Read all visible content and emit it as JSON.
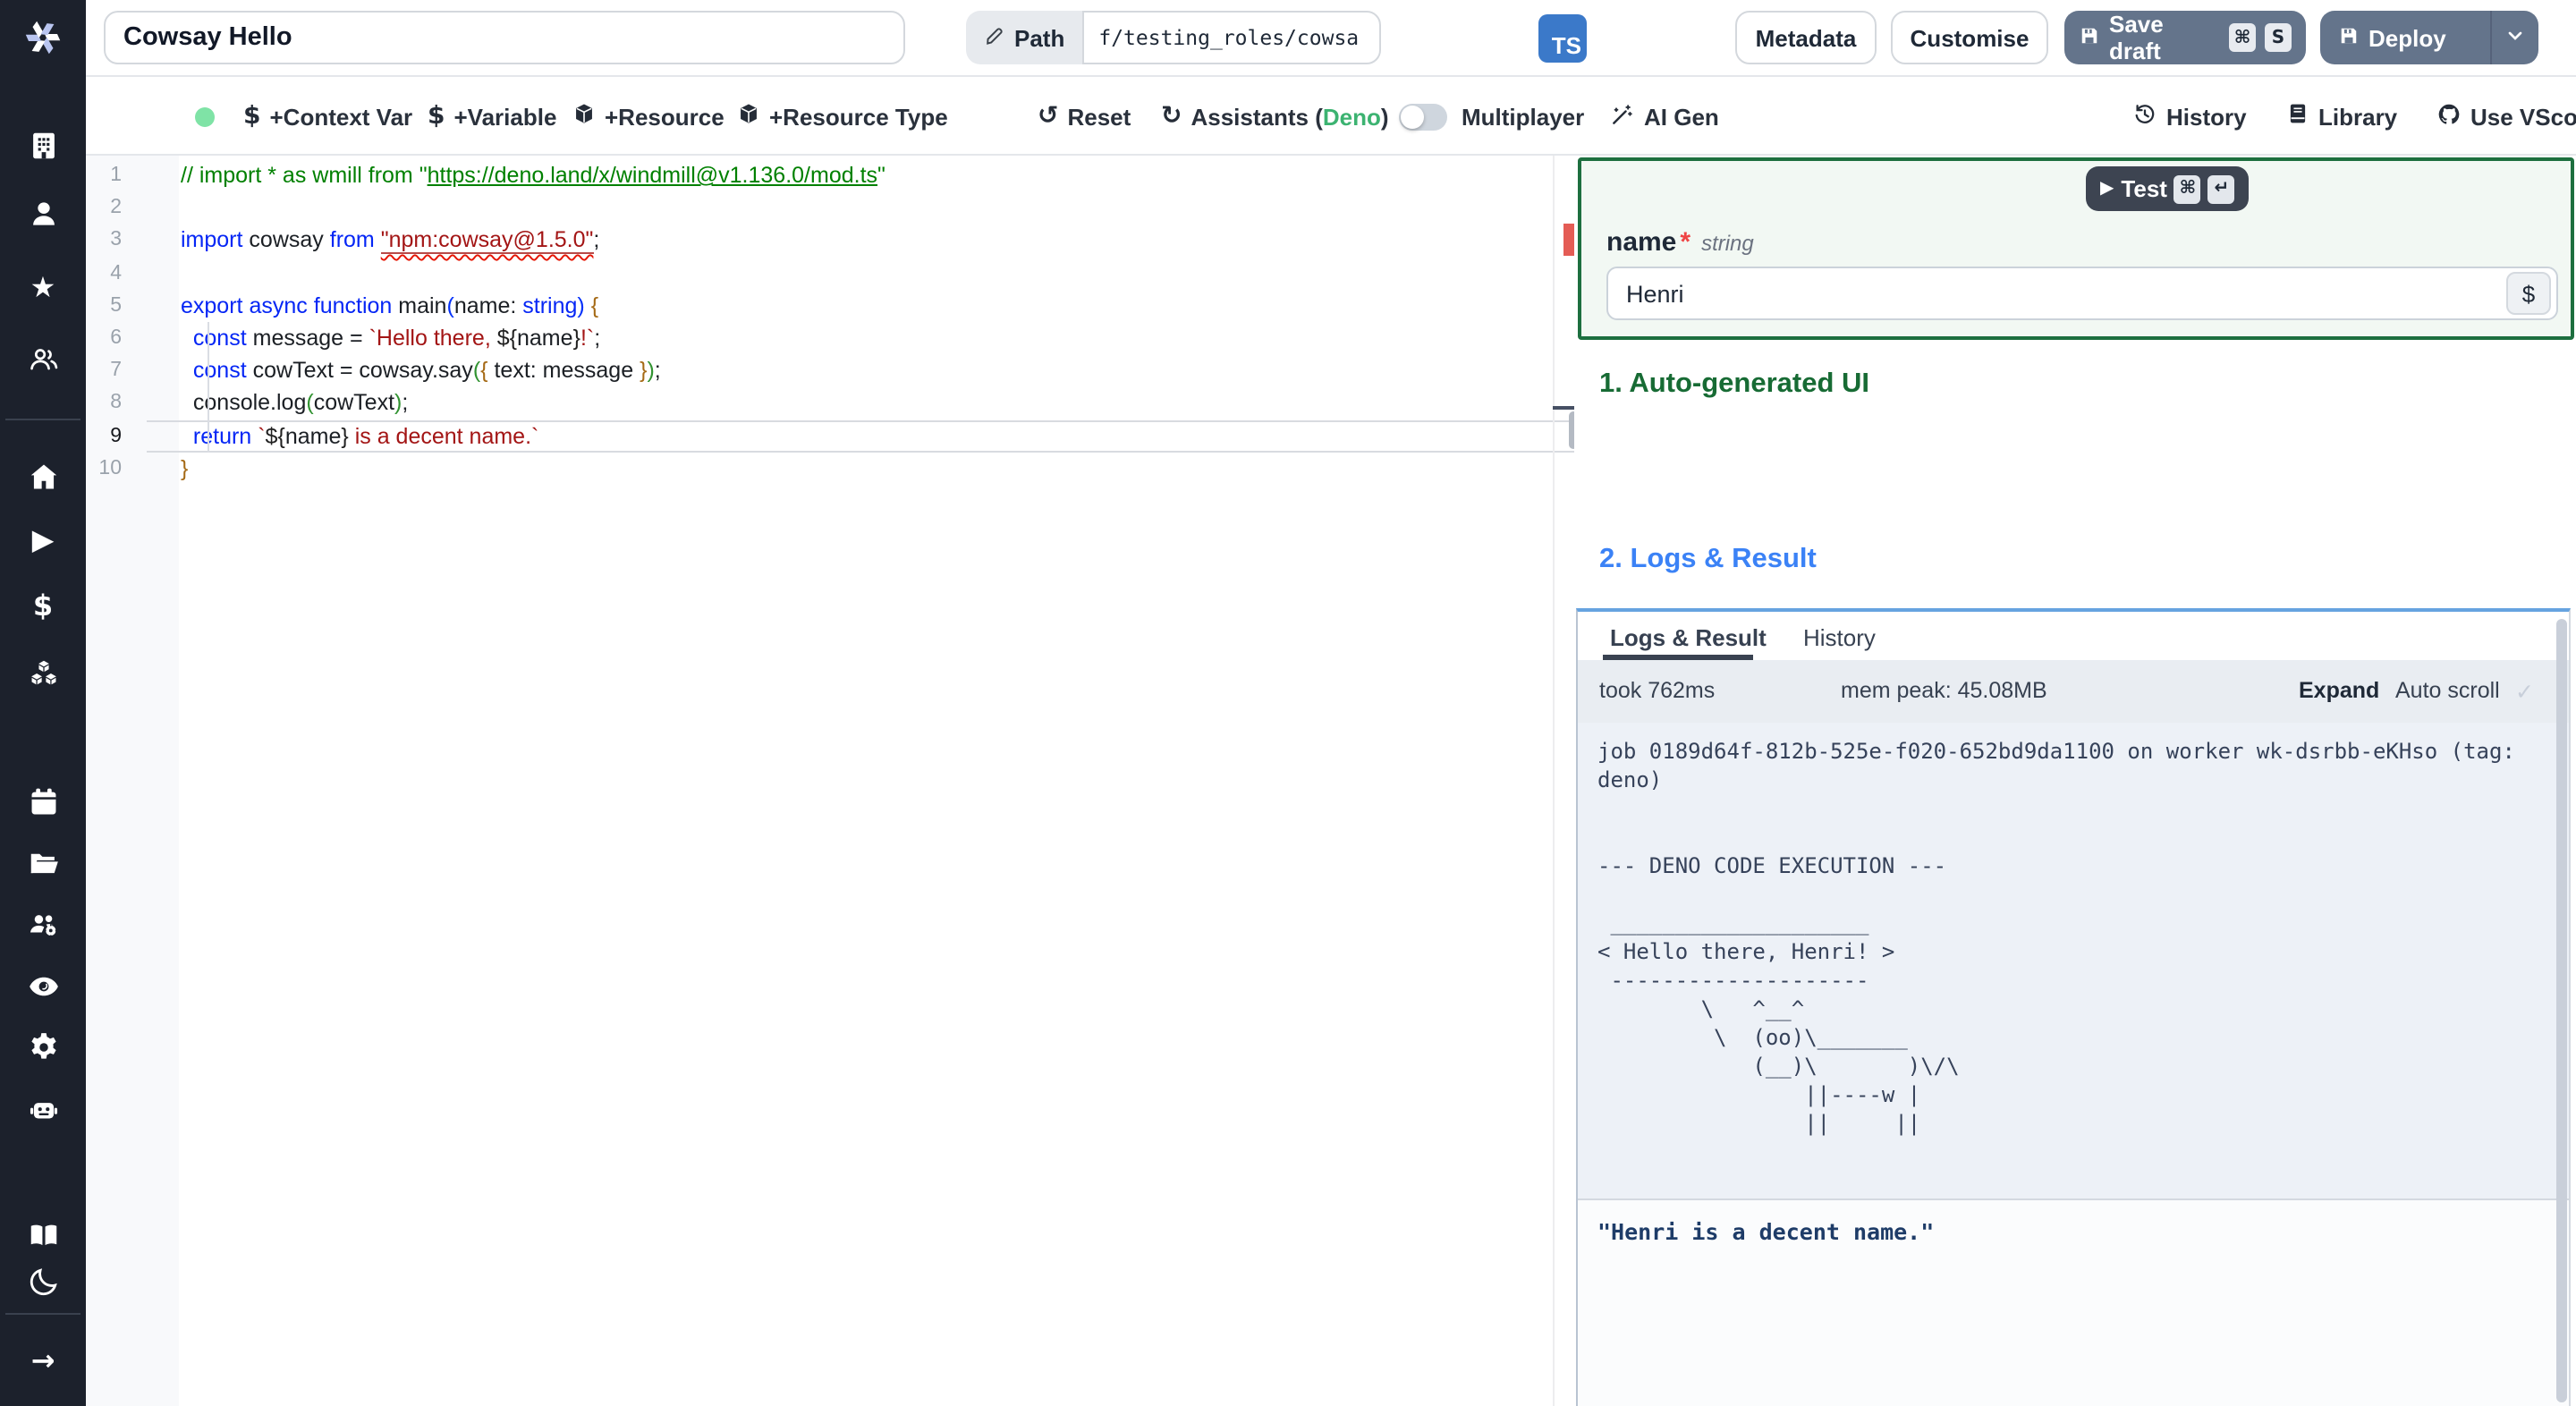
{
  "colors": {
    "sidebar_bg": "#1c212c",
    "button_slate": "#64748b",
    "ts_badge_blue": "#3b79c9",
    "args_border_green": "#1d6f3f",
    "heading_green": "#176b34",
    "heading_blue": "#3b82f6",
    "logs_top_border_blue": "#66a3e0",
    "error_marker_red": "#e45c55",
    "status_dot_green": "#7fe3a6",
    "deno_green": "#3cb371"
  },
  "icons": {
    "dollar": "$",
    "reset": "↺",
    "refresh": "↻",
    "star": "★",
    "play": "▶",
    "arrow_right": "→",
    "check": "✓",
    "command": "⌘",
    "return": "↵",
    "chevron_down": "⌄"
  },
  "topbar": {
    "title_value": "Cowsay Hello",
    "path_label": "Path",
    "path_value": "f/testing_roles/cowsa",
    "lang_badge": "TS",
    "metadata_label": "Metadata",
    "customise_label": "Customise",
    "save_draft_label": "Save draft",
    "save_kbd_1": "⌘",
    "save_kbd_2": "S",
    "deploy_label": "Deploy"
  },
  "toolbar": {
    "context_var": "+Context Var",
    "variable": "+Variable",
    "resource": "+Resource",
    "resource_type": "+Resource Type",
    "reset": "Reset",
    "assistants_prefix": "Assistants (",
    "assistants_lang": "Deno",
    "assistants_suffix": ")",
    "multiplayer": "Multiplayer",
    "ai_gen": "AI Gen",
    "history": "History",
    "library": "Library",
    "vscode": "Use VScode"
  },
  "sidebar": {
    "items": [
      "building",
      "user",
      "star",
      "users",
      "home",
      "play",
      "dollar",
      "cubes",
      "calendar",
      "folder",
      "user-group-gear",
      "eye",
      "gear",
      "robot",
      "book",
      "moon",
      "arrow-right"
    ]
  },
  "editor": {
    "language": "typescript",
    "active_line": 9,
    "lines": [
      {
        "n": 1,
        "t": [
          [
            "c",
            "// import * as wmill from \""
          ],
          [
            "cl",
            "https://deno.land/x/windmill@v1.136.0/mod.ts"
          ],
          [
            "c",
            "\""
          ]
        ]
      },
      {
        "n": 2,
        "t": []
      },
      {
        "n": 3,
        "t": [
          [
            "k",
            "import"
          ],
          [
            "p",
            " cowsay "
          ],
          [
            "k",
            "from"
          ],
          [
            "p",
            " "
          ],
          [
            "se",
            "\"npm:cowsay@1.5.0\""
          ],
          [
            "p",
            ";"
          ]
        ]
      },
      {
        "n": 4,
        "t": []
      },
      {
        "n": 5,
        "t": [
          [
            "k",
            "export"
          ],
          [
            "p",
            " "
          ],
          [
            "k",
            "async"
          ],
          [
            "p",
            " "
          ],
          [
            "k",
            "function"
          ],
          [
            "p",
            " main"
          ],
          [
            "bb",
            "("
          ],
          [
            "p",
            "name: "
          ],
          [
            "k",
            "string"
          ],
          [
            "bb",
            ")"
          ],
          [
            "p",
            " "
          ],
          [
            "by",
            "{"
          ]
        ]
      },
      {
        "n": 6,
        "t": [
          [
            "p",
            "  "
          ],
          [
            "k",
            "const"
          ],
          [
            "p",
            " message = "
          ],
          [
            "s",
            "`Hello there, "
          ],
          [
            "pn",
            "${"
          ],
          [
            "p",
            "name"
          ],
          [
            "pn",
            "}"
          ],
          [
            "s",
            "!`"
          ],
          [
            "p",
            ";"
          ]
        ]
      },
      {
        "n": 7,
        "t": [
          [
            "p",
            "  "
          ],
          [
            "k",
            "const"
          ],
          [
            "p",
            " cowText = cowsay.say"
          ],
          [
            "bg",
            "("
          ],
          [
            "by",
            "{"
          ],
          [
            "p",
            " text: message "
          ],
          [
            "by",
            "}"
          ],
          [
            "bg",
            ")"
          ],
          [
            "p",
            ";"
          ]
        ]
      },
      {
        "n": 8,
        "t": [
          [
            "p",
            "  console.log"
          ],
          [
            "bg",
            "("
          ],
          [
            "p",
            "cowText"
          ],
          [
            "bg",
            ")"
          ],
          [
            "p",
            ";"
          ]
        ]
      },
      {
        "n": 9,
        "t": [
          [
            "p",
            "  "
          ],
          [
            "k",
            "return"
          ],
          [
            "p",
            " "
          ],
          [
            "s",
            "`"
          ],
          [
            "pn",
            "${"
          ],
          [
            "p",
            "name"
          ],
          [
            "pn",
            "}"
          ],
          [
            "s",
            " is a decent name.`"
          ]
        ]
      },
      {
        "n": 10,
        "t": [
          [
            "by",
            "}"
          ]
        ]
      }
    ]
  },
  "preview": {
    "test_label": "Test",
    "test_kbd_1": "⌘",
    "test_kbd_2": "↵",
    "arg_name": "name",
    "arg_required": "*",
    "arg_type": "string",
    "arg_value": "Henri",
    "var_picker": "$",
    "section_1": "1. Auto-generated UI",
    "section_2": "2. Logs & Result",
    "tabs": [
      "Logs & Result",
      "History"
    ],
    "took": "took 762ms",
    "mem_peak": "mem peak: 45.08MB",
    "expand": "Expand",
    "auto_scroll": "Auto scroll",
    "auto_scroll_check": "✓",
    "log": "job 0189d64f-812b-525e-f020-652bd9da1100 on worker wk-dsrbb-eKHso (tag:\ndeno)\n\n\n--- DENO CODE EXECUTION ---\n\n ____________________\n< Hello there, Henri! >\n --------------------\n        \\   ^__^\n         \\  (oo)\\_______\n            (__)\\       )\\/\\\n                ||----w |\n                ||     ||",
    "result": "\"Henri is a decent name.\""
  }
}
